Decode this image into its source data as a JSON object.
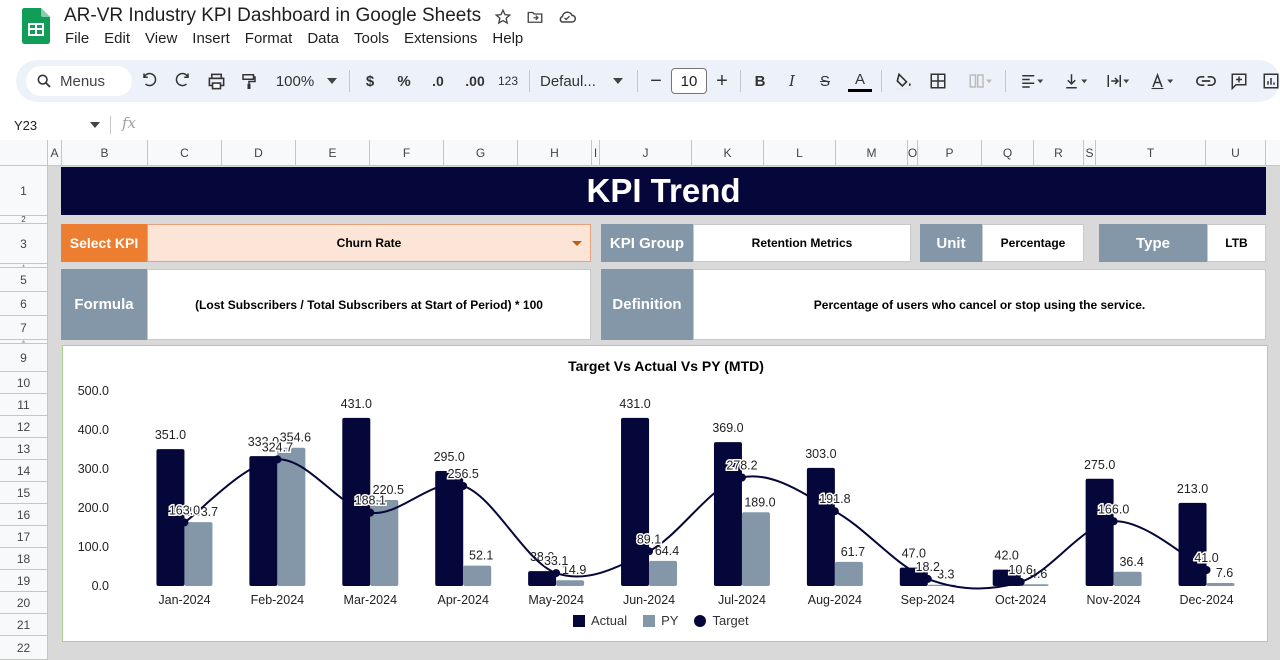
{
  "app": {
    "doc_title": "AR-VR Industry KPI Dashboard in Google Sheets",
    "menus": [
      "File",
      "Edit",
      "View",
      "Insert",
      "Format",
      "Data",
      "Tools",
      "Extensions",
      "Help"
    ],
    "icons": {
      "star": "star-icon",
      "move": "move-folder-icon",
      "cloud": "cloud-status-icon"
    }
  },
  "toolbar": {
    "search_label": "Menus",
    "zoom": "100%",
    "currency": "$",
    "percent": "%",
    "dec_decrease": ".0",
    "dec_increase": ".00",
    "number_format": "123",
    "font": "Defaul...",
    "font_size": "10",
    "minus": "−",
    "plus": "+",
    "bold": "B",
    "italic": "I",
    "strike": "S",
    "text_color": "A"
  },
  "formula_bar": {
    "cell_ref": "Y23",
    "fx": "fx",
    "value": ""
  },
  "grid": {
    "columns": [
      "A",
      "B",
      "C",
      "D",
      "E",
      "F",
      "G",
      "H",
      "I",
      "J",
      "K",
      "L",
      "M",
      "O",
      "P",
      "Q",
      "R",
      "S",
      "T",
      "U"
    ],
    "rows": [
      "1",
      "2",
      "3",
      "4",
      "5",
      "6",
      "7",
      "8",
      "9",
      "10",
      "11",
      "12",
      "13",
      "14",
      "15",
      "16",
      "17",
      "18",
      "19",
      "20",
      "21",
      "22"
    ]
  },
  "dashboard": {
    "banner": "KPI Trend",
    "select_kpi_label": "Select KPI",
    "select_kpi_value": "Churn Rate",
    "kpi_group_label": "KPI Group",
    "kpi_group_value": "Retention Metrics",
    "unit_label": "Unit",
    "unit_value": "Percentage",
    "type_label": "Type",
    "type_value": "LTB",
    "formula_label": "Formula",
    "formula_value": "(Lost Subscribers / Total Subscribers at Start of Period) * 100",
    "definition_label": "Definition",
    "definition_value": "Percentage of users who cancel or stop using the service."
  },
  "colors": {
    "navy": "#05073a",
    "grey_blue": "#8497a8",
    "orange": "#ed7d31",
    "peach": "#fce4d6",
    "py_bar": "#8497a8",
    "actual_bar": "#05073a",
    "target_line": "#05073a"
  },
  "chart_data": {
    "type": "bar",
    "title": "Target Vs Actual Vs PY (MTD)",
    "categories": [
      "Jan-2024",
      "Feb-2024",
      "Mar-2024",
      "Apr-2024",
      "May-2024",
      "Jun-2024",
      "Jul-2024",
      "Aug-2024",
      "Sep-2024",
      "Oct-2024",
      "Nov-2024",
      "Dec-2024"
    ],
    "series": [
      {
        "name": "Actual",
        "kind": "bar",
        "values": [
          351.0,
          333.0,
          431.0,
          295.0,
          38.0,
          431.0,
          369.0,
          303.0,
          47.0,
          42.0,
          275.0,
          213.0
        ]
      },
      {
        "name": "PY",
        "kind": "bar",
        "values": [
          163.7,
          354.6,
          220.5,
          52.1,
          14.9,
          64.4,
          189.0,
          61.7,
          3.3,
          4.6,
          36.4,
          7.6
        ]
      },
      {
        "name": "Target",
        "kind": "line",
        "values": [
          163.0,
          324.7,
          188.1,
          256.5,
          33.1,
          89.1,
          278.2,
          191.8,
          18.2,
          10.6,
          166.0,
          41.0
        ]
      }
    ],
    "y_ticks": [
      "0.0",
      "100.0",
      "200.0",
      "300.0",
      "400.0",
      "500.0"
    ],
    "ylim": [
      0,
      500
    ],
    "grid": false,
    "legend_position": "bottom"
  }
}
